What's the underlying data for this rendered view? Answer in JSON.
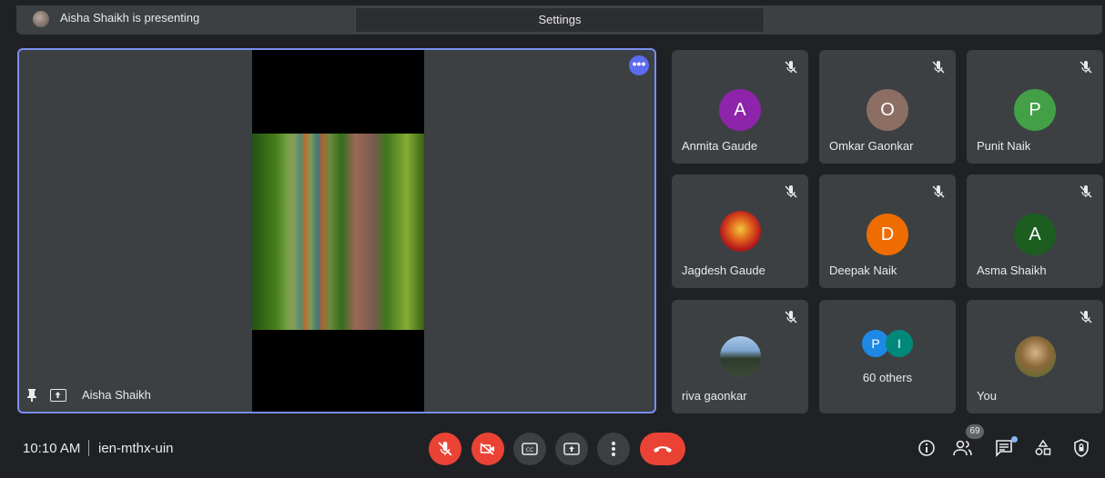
{
  "top": {
    "presenting_text": "Aisha Shaikh is presenting",
    "settings_label": "Settings"
  },
  "presentation": {
    "presenter_name": "Aisha Shaikh",
    "more_glyph": "•••"
  },
  "participants": [
    {
      "name": "Anmita Gaude",
      "initial": "A",
      "color": "#8e24aa"
    },
    {
      "name": "Omkar Gaonkar",
      "initial": "O",
      "color": "#8d6e63"
    },
    {
      "name": "Punit Naik",
      "initial": "P",
      "color": "#43a047"
    },
    {
      "name": "Jagdesh Gaude",
      "initial": "",
      "color": "#c62828"
    },
    {
      "name": "Deepak Naik",
      "initial": "D",
      "color": "#ef6c00"
    },
    {
      "name": "Asma Shaikh",
      "initial": "A",
      "color": "#1b5e20"
    },
    {
      "name": "riva gaonkar",
      "initial": "",
      "color": "#607d8b"
    },
    {
      "name": "You",
      "initial": "",
      "color": "#6d4c41"
    }
  ],
  "others": {
    "label": "60 others",
    "avatars": [
      {
        "initial": "P",
        "color": "#1e88e5"
      },
      {
        "initial": "I",
        "color": "#00897b"
      }
    ]
  },
  "bottom": {
    "time": "10:10 AM",
    "meeting_code": "ien-mthx-uin",
    "people_count": "69"
  },
  "colors": {
    "background": "#202124",
    "tile": "#3c4043",
    "accent_border": "#7a8ef0",
    "danger": "#ea4335"
  }
}
